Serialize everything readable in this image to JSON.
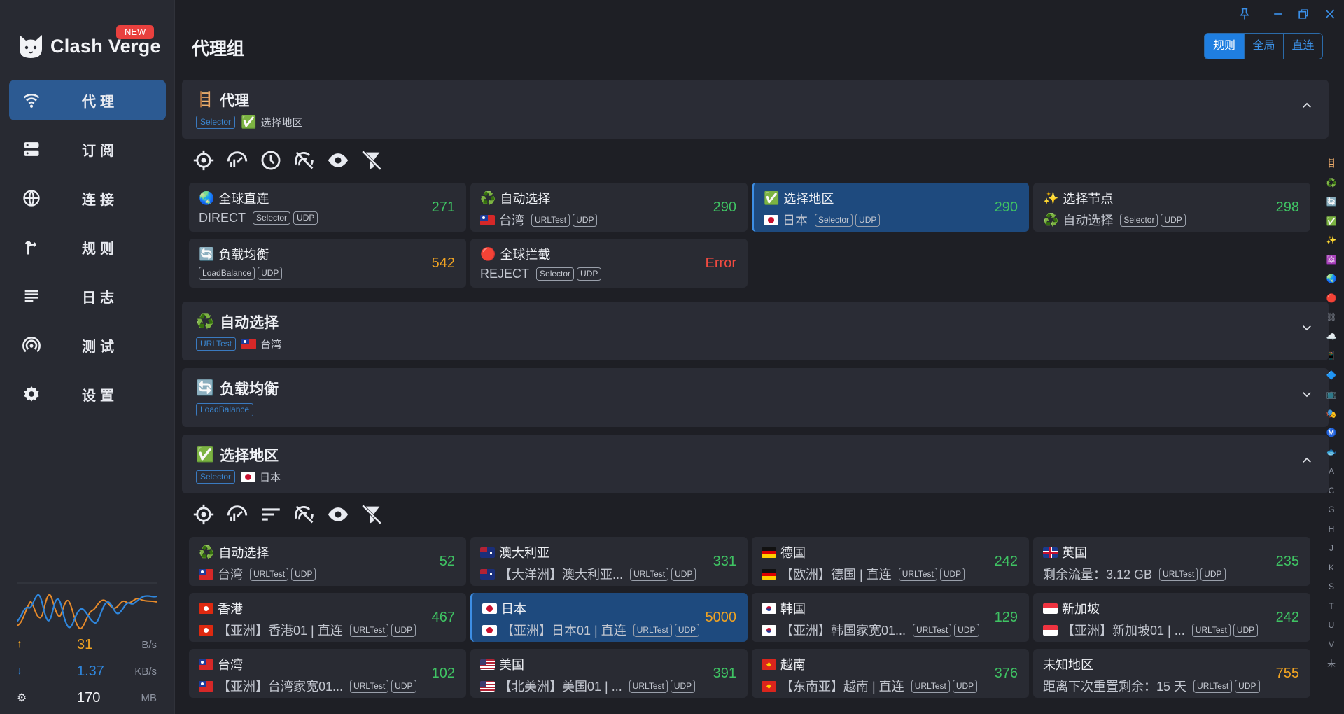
{
  "app": {
    "name": "Clash Verge",
    "badge": "NEW"
  },
  "nav": [
    {
      "label": "代理",
      "icon": "wifi-icon",
      "active": true
    },
    {
      "label": "订阅",
      "icon": "server-icon",
      "active": false
    },
    {
      "label": "连接",
      "icon": "globe-icon",
      "active": false
    },
    {
      "label": "规则",
      "icon": "fork-icon",
      "active": false
    },
    {
      "label": "日志",
      "icon": "list-icon",
      "active": false
    },
    {
      "label": "测试",
      "icon": "signal-icon",
      "active": false
    },
    {
      "label": "设置",
      "icon": "gear-icon",
      "active": false
    }
  ],
  "traffic": {
    "up_value": "31",
    "up_unit": "B/s",
    "down_value": "1.37",
    "down_unit": "KB/s",
    "mem_value": "170",
    "mem_unit": "MB"
  },
  "header": {
    "title": "代理组",
    "modes": [
      "规则",
      "全局",
      "直连"
    ],
    "active_mode": "规则"
  },
  "groups": [
    {
      "title": "代理",
      "emoji": "🪜",
      "type": "Selector",
      "current": "选择地区",
      "current_emoji": "✅",
      "expanded": true
    },
    {
      "title": "自动选择",
      "emoji": "♻️",
      "type": "URLTest",
      "current": "台湾",
      "current_flag": "tw",
      "expanded": false
    },
    {
      "title": "负载均衡",
      "emoji": "🔄",
      "type": "LoadBalance",
      "current": "",
      "expanded": false
    },
    {
      "title": "选择地区",
      "emoji": "✅",
      "type": "Selector",
      "current": "日本",
      "current_flag": "jp",
      "expanded": true
    }
  ],
  "group1_cards": [
    {
      "name": "全球直连",
      "emoji": "🌏",
      "sub": "DIRECT",
      "tags": [
        "Selector",
        "UDP"
      ],
      "delay": "271",
      "color": "green"
    },
    {
      "name": "自动选择",
      "emoji": "♻️",
      "sub": "台湾",
      "sub_flag": "tw",
      "tags": [
        "URLTest",
        "UDP"
      ],
      "delay": "290",
      "color": "green"
    },
    {
      "name": "选择地区",
      "emoji": "✅",
      "sub": "日本",
      "sub_flag": "jp",
      "tags": [
        "Selector",
        "UDP"
      ],
      "delay": "290",
      "color": "green",
      "selected": true
    },
    {
      "name": "选择节点",
      "emoji": "✨",
      "sub": "自动选择",
      "sub_emoji": "♻️",
      "tags": [
        "Selector",
        "UDP"
      ],
      "delay": "298",
      "color": "green"
    },
    {
      "name": "负载均衡",
      "emoji": "🔄",
      "sub": "",
      "tags": [
        "LoadBalance",
        "UDP"
      ],
      "delay": "542",
      "color": "orange"
    },
    {
      "name": "全球拦截",
      "emoji": "🔴",
      "sub": "REJECT",
      "tags": [
        "Selector",
        "UDP"
      ],
      "delay": "Error",
      "color": "red"
    }
  ],
  "group4_cards": [
    {
      "name": "自动选择",
      "emoji": "♻️",
      "sub": "台湾",
      "sub_flag": "tw",
      "tags": [
        "URLTest",
        "UDP"
      ],
      "delay": "52",
      "color": "green"
    },
    {
      "name": "澳大利亚",
      "flag": "au",
      "sub": "【大洋洲】澳大利亚...",
      "sub_flag": "au",
      "tags": [
        "URLTest",
        "UDP"
      ],
      "delay": "331",
      "color": "green"
    },
    {
      "name": "德国",
      "flag": "de",
      "sub": "【欧洲】德国 | 直连",
      "sub_flag": "de",
      "tags": [
        "URLTest",
        "UDP"
      ],
      "delay": "242",
      "color": "green"
    },
    {
      "name": "英国",
      "flag": "gb",
      "sub": "剩余流量：3.12 GB",
      "tags": [
        "URLTest",
        "UDP"
      ],
      "delay": "235",
      "color": "green"
    },
    {
      "name": "香港",
      "flag": "hk",
      "sub": "【亚洲】香港01 | 直连",
      "sub_flag": "hk",
      "tags": [
        "URLTest",
        "UDP"
      ],
      "delay": "467",
      "color": "green"
    },
    {
      "name": "日本",
      "flag": "jp",
      "sub": "【亚洲】日本01 | 直连",
      "sub_flag": "jp",
      "tags": [
        "URLTest",
        "UDP"
      ],
      "delay": "5000",
      "color": "orange",
      "selected": true
    },
    {
      "name": "韩国",
      "flag": "kr",
      "sub": "【亚洲】韩国家宽01...",
      "sub_flag": "kr",
      "tags": [
        "URLTest",
        "UDP"
      ],
      "delay": "129",
      "color": "green"
    },
    {
      "name": "新加坡",
      "flag": "sg",
      "sub": "【亚洲】新加坡01 | ...",
      "sub_flag": "sg",
      "tags": [
        "URLTest",
        "UDP"
      ],
      "delay": "242",
      "color": "green"
    },
    {
      "name": "台湾",
      "flag": "tw",
      "sub": "【亚洲】台湾家宽01...",
      "sub_flag": "tw",
      "tags": [
        "URLTest",
        "UDP"
      ],
      "delay": "102",
      "color": "green"
    },
    {
      "name": "美国",
      "flag": "us",
      "sub": "【北美洲】美国01 | ...",
      "sub_flag": "us",
      "tags": [
        "URLTest",
        "UDP"
      ],
      "delay": "391",
      "color": "green"
    },
    {
      "name": "越南",
      "flag": "vn",
      "sub": "【东南亚】越南 | 直连",
      "sub_flag": "vn",
      "tags": [
        "URLTest",
        "UDP"
      ],
      "delay": "376",
      "color": "green"
    },
    {
      "name": "未知地区",
      "sub": "距离下次重置剩余：15 天",
      "tags": [
        "URLTest",
        "UDP"
      ],
      "delay": "755",
      "color": "orange"
    }
  ],
  "index_letters": [
    "🪜",
    "♻️",
    "🔄",
    "✅",
    "✨",
    "🔯",
    "🌏",
    "🔴",
    "⛓",
    "☁️",
    "📱",
    "🔷",
    "📺",
    "🎭",
    "Ⓜ️",
    "🐟",
    "A",
    "C",
    "G",
    "H",
    "J",
    "K",
    "S",
    "T",
    "U",
    "V",
    "未"
  ]
}
